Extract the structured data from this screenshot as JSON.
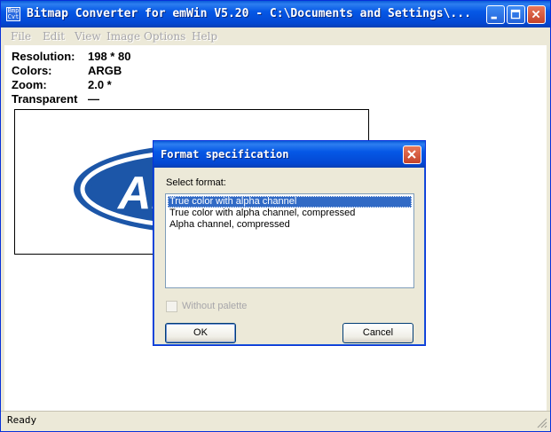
{
  "window": {
    "title": "Bitmap Converter for emWin V5.20 - C:\\Documents and Settings\\...",
    "icon_text_top": "Bmp",
    "icon_text_bottom": "Cvt",
    "controls": [
      "minimize-icon",
      "maximize-icon",
      "close-icon"
    ]
  },
  "menu": {
    "items": [
      "File",
      "Edit",
      "View",
      "Image",
      "Options",
      "Help"
    ]
  },
  "info": {
    "resolution_label": "Resolution:",
    "resolution_value": "198 * 80",
    "colors_label": "Colors:",
    "colors_value": "ARGB",
    "zoom_label": "Zoom:",
    "zoom_value": "2.0 *",
    "transparent_label": "Transparent",
    "transparent_value": "—"
  },
  "preview": {
    "logo_text": "ARM",
    "logo_color": "#1c56a8"
  },
  "status": {
    "text": "Ready"
  },
  "dialog": {
    "title": "Format specification",
    "select_label": "Select format:",
    "options": [
      "True color with alpha channel",
      "True color with alpha channel, compressed",
      "Alpha channel, compressed"
    ],
    "selected_index": 0,
    "checkbox_label": "Without palette",
    "checkbox_checked": false,
    "ok_label": "OK",
    "cancel_label": "Cancel"
  },
  "colors": {
    "titlebar": "#0558e6",
    "selection": "#316ac5",
    "window_bg": "#ece9d8"
  }
}
